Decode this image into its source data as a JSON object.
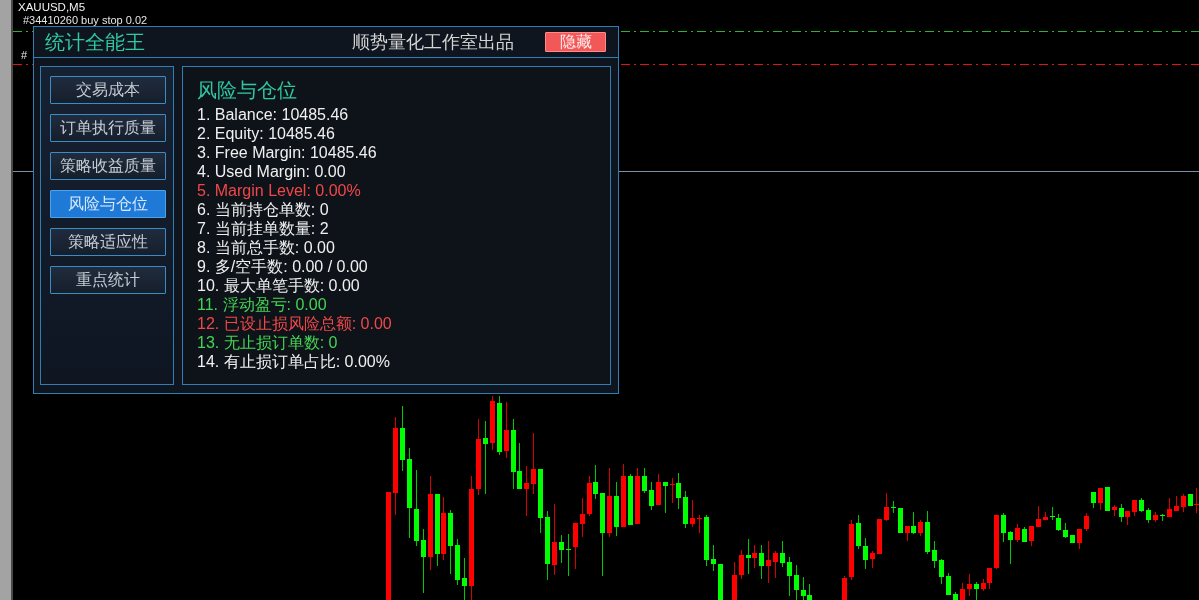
{
  "chart": {
    "symbol": "XAUUSD,M5",
    "order_labels": [
      "#34410260 buy stop 0.02",
      "#"
    ]
  },
  "panel": {
    "title": "统计全能王",
    "subtitle": "顺势量化工作室出品",
    "hide_button": "隐藏",
    "nav": [
      {
        "label": "交易成本",
        "selected": false
      },
      {
        "label": "订单执行质量",
        "selected": false
      },
      {
        "label": "策略收益质量",
        "selected": false
      },
      {
        "label": "风险与仓位",
        "selected": true
      },
      {
        "label": "策略适应性",
        "selected": false
      },
      {
        "label": "重点统计",
        "selected": false
      }
    ],
    "section": {
      "heading": "风险与仓位",
      "lines": [
        {
          "text": "1. Balance: 10485.46",
          "color": "#f0f0f0"
        },
        {
          "text": "2. Equity: 10485.46",
          "color": "#f0f0f0"
        },
        {
          "text": "3. Free Margin: 10485.46",
          "color": "#f0f0f0"
        },
        {
          "text": "4. Used Margin: 0.00",
          "color": "#f0f0f0"
        },
        {
          "text": "5. Margin Level: 0.00%",
          "color": "#f04848"
        },
        {
          "text": "6. 当前持仓单数: 0",
          "color": "#f0f0f0"
        },
        {
          "text": "7. 当前挂单数量: 2",
          "color": "#f0f0f0"
        },
        {
          "text": "8. 当前总手数: 0.00",
          "color": "#f0f0f0"
        },
        {
          "text": "9. 多/空手数: 0.00 / 0.00",
          "color": "#f0f0f0"
        },
        {
          "text": "10. 最大单笔手数: 0.00",
          "color": "#f0f0f0"
        },
        {
          "text": "11. 浮动盈亏: 0.00",
          "color": "#44d454"
        },
        {
          "text": "12. 已设止损风险总额: 0.00",
          "color": "#f04848"
        },
        {
          "text": "13. 无止损订单数: 0",
          "color": "#44d454"
        },
        {
          "text": "14. 有止损订单占比: 0.00%",
          "color": "#f0f0f0"
        }
      ]
    }
  }
}
